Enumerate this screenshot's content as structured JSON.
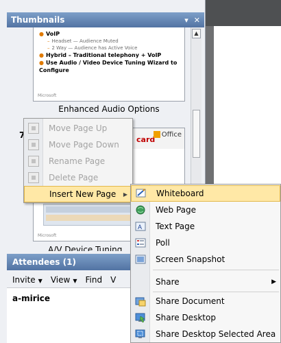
{
  "thumbnails_panel": {
    "title": "Thumbnails",
    "menu_btn": "▾",
    "close_btn": "✕",
    "slides": [
      {
        "bullets": [
          {
            "text": "VoIP",
            "level": 1
          },
          {
            "text": "Headset — Audience Muted",
            "level": 2
          },
          {
            "text": "2 Way — Audience has Active Voice",
            "level": 2
          },
          {
            "text": "Hybrid – Traditional telephony + VoIP",
            "level": 1
          },
          {
            "text": "Use Audio / Video Device Tuning Wizard to Configure",
            "level": 1
          }
        ],
        "footer": "Microsoft",
        "label": "Enhanced Audio Options"
      },
      {
        "number": "7",
        "office_label": "Office",
        "title_fragment": "card",
        "footer": "Microsoft",
        "label": "A/V Device Tuning Wizard"
      }
    ]
  },
  "attendees_panel": {
    "title": "Attendees (1)",
    "toolbar": [
      {
        "label": "Invite",
        "dropdown": true
      },
      {
        "label": "View",
        "dropdown": true
      },
      {
        "label": "Find",
        "dropdown": false
      },
      {
        "label": "V",
        "dropdown": false
      }
    ],
    "attendees": [
      "a-mirice"
    ]
  },
  "context_menu": {
    "items": [
      {
        "label": "Move Page Up",
        "disabled": true
      },
      {
        "label": "Move Page Down",
        "disabled": true
      },
      {
        "label": "Rename Page",
        "disabled": true
      },
      {
        "label": "Delete Page",
        "disabled": true
      },
      {
        "label": "Insert New Page",
        "disabled": false,
        "submenu": true,
        "highlighted": true
      }
    ]
  },
  "insert_submenu": {
    "items": [
      {
        "label": "Whiteboard",
        "icon": "whiteboard-icon",
        "highlighted": true
      },
      {
        "label": "Web Page",
        "icon": "globe-icon"
      },
      {
        "label": "Text Page",
        "icon": "text-page-icon"
      },
      {
        "label": "Poll",
        "icon": "poll-icon"
      },
      {
        "label": "Screen Snapshot",
        "icon": "screen-snapshot-icon"
      },
      {
        "label": "Share",
        "icon": "",
        "submenu": true
      },
      {
        "label": "Share Document",
        "icon": "share-document-icon"
      },
      {
        "label": "Share Desktop",
        "icon": "share-desktop-icon"
      },
      {
        "label": "Share Desktop Selected Area",
        "icon": "share-selected-area-icon"
      }
    ]
  },
  "colors": {
    "panel_header": "#5273a3",
    "menu_highlight": "#ffe8a6",
    "menu_highlight_border": "#e2b84b",
    "disabled_text": "#a3a3a3",
    "bullet_orange": "#e07a00"
  }
}
